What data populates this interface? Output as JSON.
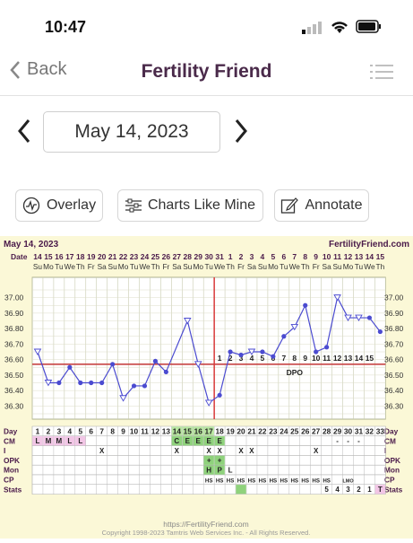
{
  "status_bar": {
    "time": "10:47"
  },
  "nav": {
    "back_label": "Back",
    "title": "Fertility Friend"
  },
  "date_picker": {
    "value": "May 14, 2023"
  },
  "buttons": {
    "overlay": "Overlay",
    "charts_like_mine": "Charts Like Mine",
    "annotate": "Annotate"
  },
  "chart_header": {
    "date_label": "May 14, 2023",
    "brand": "FertilityFriend.com"
  },
  "chart_data": {
    "type": "line",
    "x_dates": [
      "14",
      "15",
      "16",
      "17",
      "18",
      "19",
      "20",
      "21",
      "22",
      "23",
      "24",
      "25",
      "26",
      "27",
      "28",
      "29",
      "30",
      "31",
      "1",
      "2",
      "3",
      "4",
      "5",
      "6",
      "7",
      "8",
      "9",
      "10",
      "11",
      "12",
      "13",
      "14",
      "15"
    ],
    "x_weekdays": [
      "Su",
      "Mo",
      "Tu",
      "We",
      "Th",
      "Fr",
      "Sa",
      "Su",
      "Mo",
      "Tu",
      "We",
      "Th",
      "Fr",
      "Sa",
      "Su",
      "Mo",
      "Tu",
      "We",
      "Th",
      "Fr",
      "Sa",
      "Su",
      "Mo",
      "Tu",
      "We",
      "Th",
      "Fr",
      "Sa",
      "Su",
      "Mo",
      "Tu",
      "We",
      "Th"
    ],
    "cycle_days": [
      1,
      2,
      3,
      4,
      5,
      6,
      7,
      8,
      9,
      10,
      11,
      12,
      13,
      14,
      15,
      16,
      17,
      18,
      19,
      20,
      21,
      22,
      23,
      24,
      25,
      26,
      27,
      28,
      29,
      30,
      31,
      32,
      33
    ],
    "temps": [
      36.65,
      36.45,
      36.45,
      36.55,
      36.45,
      36.45,
      36.45,
      36.57,
      36.35,
      36.43,
      36.43,
      36.59,
      36.52,
      null,
      36.85,
      36.57,
      36.32,
      36.37,
      36.65,
      36.63,
      36.65,
      36.65,
      36.62,
      36.75,
      36.81,
      36.95,
      36.65,
      36.68,
      37.0,
      36.87,
      36.87,
      36.87,
      36.78
    ],
    "open_markers": [
      1,
      2,
      9,
      14,
      15,
      16,
      17,
      21,
      25,
      29,
      30,
      31
    ],
    "y_ticks": [
      "37.00",
      "36.90",
      "36.80",
      "36.70",
      "36.60",
      "36.50",
      "36.40",
      "36.30"
    ],
    "ylim": [
      36.25,
      37.05
    ],
    "coverline": 36.57,
    "ovulation_day": 17,
    "dpo_numbers": [
      "1",
      "2",
      "3",
      "4",
      "5",
      "6",
      "7",
      "8",
      "9",
      "10",
      "11",
      "12",
      "13",
      "14",
      "15"
    ],
    "dpo_label": "DPO",
    "row_labels": [
      "Day",
      "CM",
      "I",
      "OPK",
      "Mon",
      "CP",
      "Stats"
    ],
    "cm_cells": {
      "1": "L",
      "2": "M",
      "3": "M",
      "4": "L",
      "5": "L",
      "14": "C",
      "15": "E",
      "16": "E",
      "17": "E",
      "18": "E",
      "29": "-",
      "30": "-",
      "31": "-"
    },
    "i_cells": {
      "7": "X",
      "14": "X",
      "17": "X",
      "18": "X",
      "20": "X",
      "21": "X",
      "27": "X"
    },
    "opk_cells": {
      "17": "+",
      "18": "+"
    },
    "mon_cells": {
      "17": "H",
      "18": "P",
      "19": "L"
    },
    "cp_cells": {
      "17": "HS",
      "18": "HS",
      "19": "HS",
      "20": "HS",
      "21": "HS",
      "22": "HS",
      "23": "HS",
      "24": "HS",
      "25": "HS",
      "26": "HS",
      "27": "HS",
      "28": "HS",
      "30": "LMO"
    },
    "stats_cells": {
      "28": "5",
      "29": "4",
      "30": "3",
      "31": "2",
      "32": "1",
      "33": "T"
    },
    "colors": {
      "line": "#4b4bd0",
      "coverline": "#c84545",
      "ovulation": "#d83a3a",
      "green": "#8fd27c",
      "pink": "#f2c6e6",
      "day_fertile": "#b8e6a0"
    }
  },
  "footer": {
    "url": "https://FertilityFriend.com",
    "copyright": "Copyright 1998-2023 Tamtris Web Services Inc. - All Rights Reserved."
  }
}
